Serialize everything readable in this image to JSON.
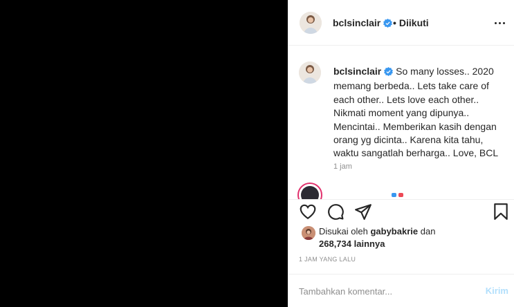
{
  "header": {
    "username": "bclsinclair",
    "separator": "•",
    "follow_status": "Diikuti"
  },
  "caption": {
    "username": "bclsinclair",
    "text": "So many losses.. 2020 memang berbeda.. Lets take care of each other.. Lets love each other.. Nikmati moment yang dipunya.. Mencintai.. Memberikan kasih dengan orang yg dicinta.. Karena kita tahu, waktu sangatlah berharga.. Love, BCL",
    "time": "1 jam"
  },
  "likes": {
    "prefix": "Disukai oleh",
    "liker": "gabybakrie",
    "and": "dan",
    "count": "268,734",
    "others": "lainnya"
  },
  "posted_ago": "1 JAM YANG LALU",
  "add_comment": {
    "placeholder": "Tambahkan komentar...",
    "post_label": "Kirim"
  },
  "colors": {
    "verified": "#3897f0",
    "post_button": "#b2dffc",
    "muted": "#8e8e8e",
    "text": "#262626"
  },
  "icons": [
    "verified-badge-icon",
    "more-options-icon",
    "heart-icon",
    "comment-icon",
    "share-icon",
    "bookmark-icon"
  ]
}
